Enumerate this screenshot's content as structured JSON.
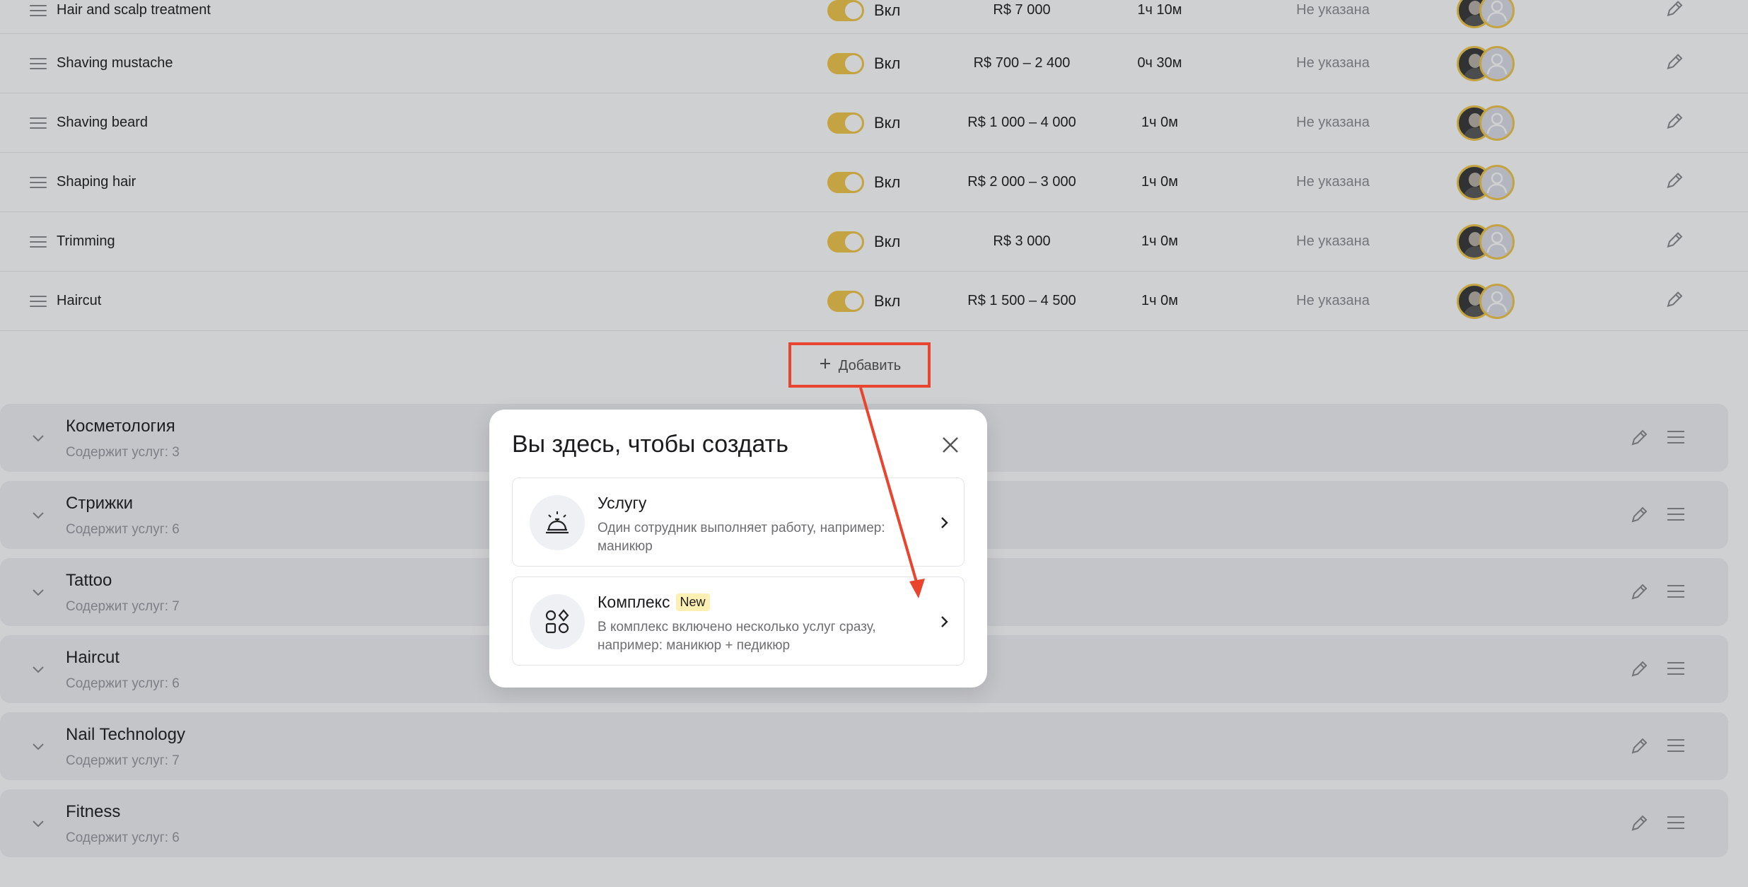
{
  "services": [
    {
      "name": "Hair and scalp treatment",
      "toggle": "Вкл",
      "price": "R$ 7 000",
      "duration": "1ч 10м",
      "status": "Не указана"
    },
    {
      "name": "Shaving mustache",
      "toggle": "Вкл",
      "price": "R$ 700 – 2 400",
      "duration": "0ч 30м",
      "status": "Не указана"
    },
    {
      "name": "Shaving beard",
      "toggle": "Вкл",
      "price": "R$ 1 000 – 4 000",
      "duration": "1ч 0м",
      "status": "Не указана"
    },
    {
      "name": "Shaping hair",
      "toggle": "Вкл",
      "price": "R$ 2 000 – 3 000",
      "duration": "1ч 0м",
      "status": "Не указана"
    },
    {
      "name": "Trimming",
      "toggle": "Вкл",
      "price": "R$ 3 000",
      "duration": "1ч 0м",
      "status": "Не указана"
    },
    {
      "name": "Haircut",
      "toggle": "Вкл",
      "price": "R$ 1 500 – 4 500",
      "duration": "1ч 0м",
      "status": "Не указана"
    }
  ],
  "add_button": {
    "label": "Добавить",
    "icon": "plus-icon"
  },
  "categories": [
    {
      "title": "Косметология",
      "subtitle": "Содержит услуг: 3"
    },
    {
      "title": "Стрижки",
      "subtitle": "Содержит услуг: 6"
    },
    {
      "title": "Tattoo",
      "subtitle": "Содержит услуг: 7"
    },
    {
      "title": "Haircut",
      "subtitle": "Содержит услуг: 6"
    },
    {
      "title": "Nail Technology",
      "subtitle": "Содержит услуг: 7"
    },
    {
      "title": "Fitness",
      "subtitle": "Содержит услуг: 6"
    }
  ],
  "modal": {
    "title": "Вы здесь, чтобы создать",
    "options": [
      {
        "title": "Услугу",
        "badge": "",
        "description": "Один сотрудник выполняет работу, например: маникюр",
        "icon": "service-bell-icon"
      },
      {
        "title": "Комплекс",
        "badge": "New",
        "description": "В комплекс включено несколько услуг сразу, например: маникюр + педикюр",
        "icon": "shapes-icon"
      }
    ]
  },
  "colors": {
    "accent_toggle": "#f2c94c",
    "highlight": "#e8442e",
    "badge_bg": "#fdf0b2"
  }
}
